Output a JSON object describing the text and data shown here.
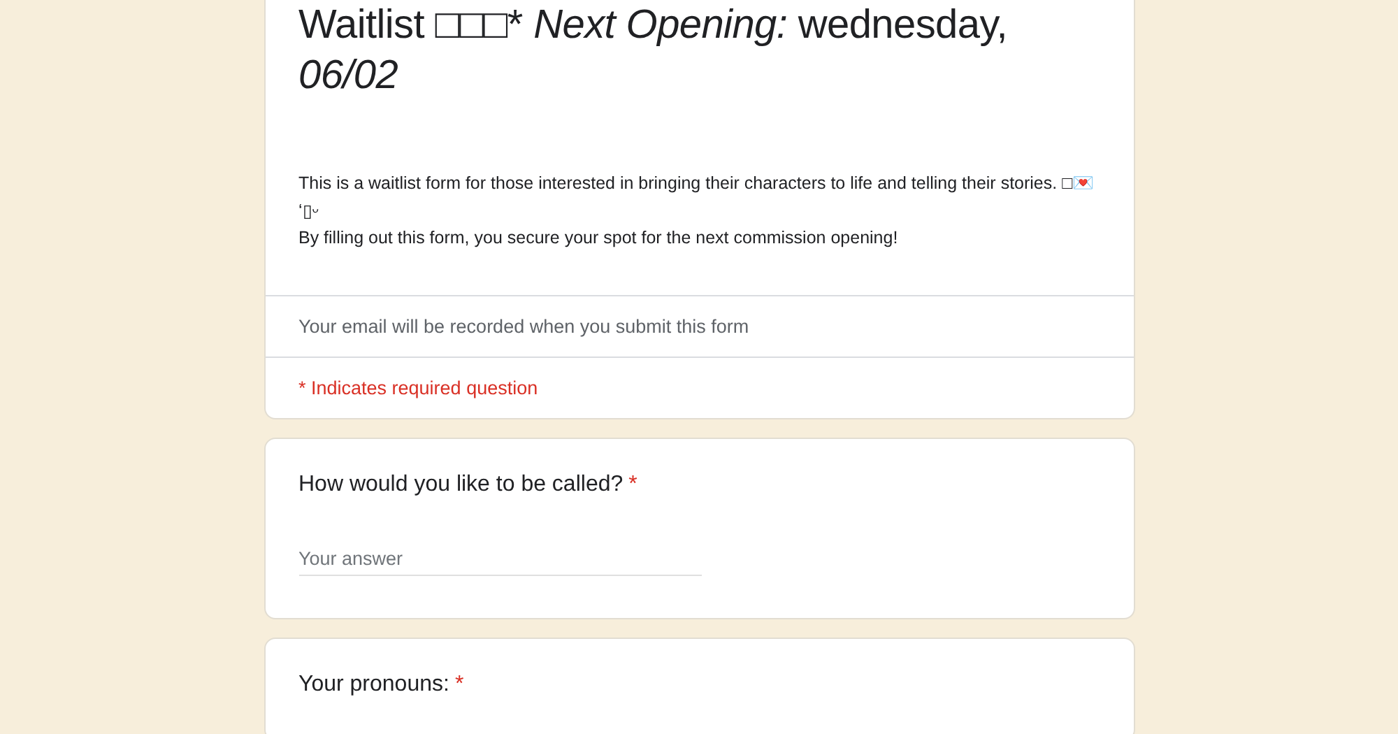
{
  "header": {
    "title": [
      {
        "text": "Waitlist □□□* ",
        "italic": false
      },
      {
        "text": "Next Opening:",
        "italic": true
      },
      {
        "text": " wednesday, ",
        "italic": false
      },
      {
        "text": "06/02",
        "italic": true
      }
    ],
    "description": [
      "This is a waitlist form for those interested in bringing their characters to life and telling their stories. □💌ʻ▯ᵕ",
      "By filling out this form, you secure your spot for the next commission opening!"
    ],
    "email_notice": "Your email will be recorded when you submit this form",
    "required_notice": "* Indicates required question"
  },
  "questions": [
    {
      "kind": "short_text",
      "label": "How would you like to be called?",
      "required_mark": "*",
      "placeholder": "Your answer"
    },
    {
      "kind": "label_only",
      "label": "Your pronouns:",
      "required_mark": "*"
    }
  ]
}
